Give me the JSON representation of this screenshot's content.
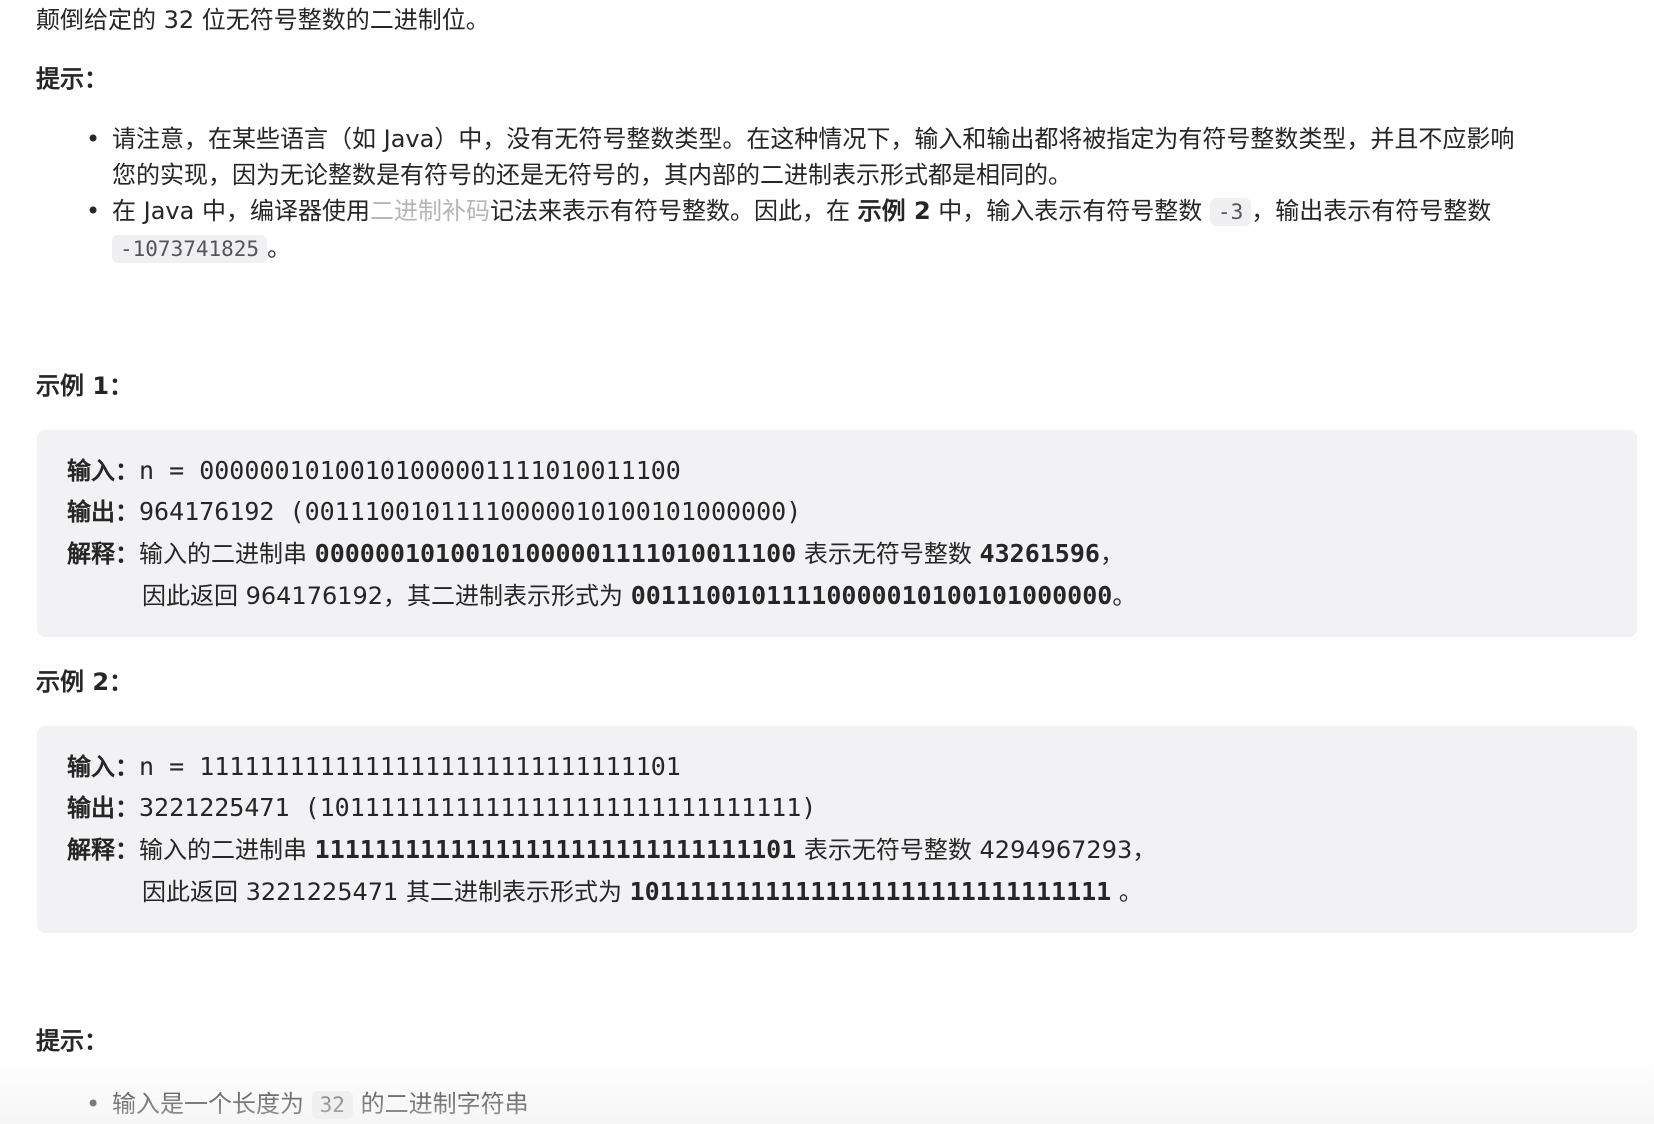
{
  "intro": "颠倒给定的 32 位无符号整数的二进制位。",
  "hint_heading_1": "提示：",
  "hints_1": {
    "item1_line1": "请注意，在某些语言（如 Java）中，没有无符号整数类型。在这种情况下，输入和输出都将被指定为有符号整数类型，并且不应影响",
    "item1_line2": "您的实现，因为无论整数是有符号的还是无符号的，其内部的二进制表示形式都是相同的。",
    "item2_part1": "在 Java 中，编译器使用",
    "item2_link": "二进制补码",
    "item2_part2": "记法来表示有符号整数。因此，在 ",
    "item2_bold": "示例 2",
    "item2_part3": " 中，输入表示有符号整数 ",
    "item2_code1": "-3",
    "item2_part4": "，输出表示有符号整数",
    "item2_code2": "-1073741825",
    "item2_end": "。"
  },
  "example1": {
    "heading": "示例 1：",
    "input_label": "输入：",
    "input_value": "n = 00000010100101000001111010011100",
    "output_label": "输出：",
    "output_value": "964176192 (00111001011110000010100101000000)",
    "explain_label": "解释：",
    "explain_l1_a": "输入的二进制串 ",
    "explain_l1_b": "00000010100101000001111010011100",
    "explain_l1_c": " 表示无符号整数 ",
    "explain_l1_d": "43261596",
    "explain_l1_e": "，",
    "explain_l2_a": "因此返回 964176192，其二进制表示形式为 ",
    "explain_l2_b": "00111001011110000010100101000000",
    "explain_l2_c": "。"
  },
  "example2": {
    "heading": "示例 2：",
    "input_label": "输入：",
    "input_value": "n = 11111111111111111111111111111101",
    "output_label": "输出：",
    "output_value": "3221225471 (10111111111111111111111111111111)",
    "explain_label": "解释：",
    "explain_l1_a": "输入的二进制串 ",
    "explain_l1_b": "11111111111111111111111111111101",
    "explain_l1_c": " 表示无符号整数 4294967293，",
    "explain_l2_a": "因此返回 3221225471 其二进制表示形式为 ",
    "explain_l2_b": "10111111111111111111111111111111",
    "explain_l2_c": " 。"
  },
  "hint_heading_2": "提示：",
  "hints_2": {
    "item1_a": "输入是一个长度为 ",
    "item1_code": "32",
    "item1_b": " 的二进制字符串"
  }
}
